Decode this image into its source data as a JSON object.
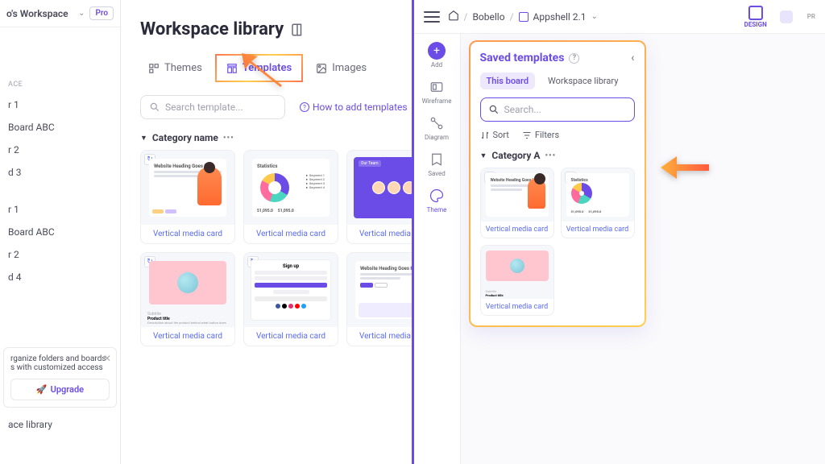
{
  "left": {
    "workspace_name": "o's Workspace",
    "pro_badge": "Pro",
    "page_title": "Workspace library",
    "tabs": {
      "themes": "Themes",
      "templates": "Templates",
      "images": "Images"
    },
    "search_placeholder": "Search template...",
    "howto": "How to add templates",
    "category_label": "Category name",
    "card_label": "Vertical media card",
    "nav": {
      "section": "ACE",
      "items1": [
        "r 1",
        "Board ABC",
        "r 2",
        "d 3"
      ],
      "items2": [
        "r 1",
        "Board ABC",
        "r 2",
        "d 4"
      ]
    },
    "promo": {
      "line1": "rganize folders and boards",
      "line2": "s with customized access",
      "upgrade": "Upgrade"
    },
    "ws_lib": "ace library",
    "mini": {
      "website_heading": "Website Heading Goes Here",
      "stats_title": "Statistics",
      "seg": [
        "Segment 1",
        "Segment 2",
        "Segment 3",
        "Segment 4"
      ],
      "sval": [
        "51,095.0",
        "51,095.0"
      ],
      "signup": "Sign up",
      "product_title": "Product title",
      "subtitle": "Subtitle",
      "desc": "Description about the product behind what button does"
    }
  },
  "right": {
    "breadcrumb": {
      "home": "⌂",
      "ws": "Bobello",
      "board": "Appshell 2.1"
    },
    "design_label": "DESIGN",
    "pr_label": "PR",
    "rail": {
      "add": "Add",
      "wireframe": "Wireframe",
      "diagram": "Diagram",
      "saved": "Saved",
      "theme": "Theme"
    },
    "panel": {
      "title": "Saved templates",
      "scope_this": "This board",
      "scope_ws": "Workspace library",
      "search_placeholder": "Search...",
      "sort": "Sort",
      "filters": "Filters",
      "category": "Category A",
      "card_label": "Vertical media card"
    }
  }
}
